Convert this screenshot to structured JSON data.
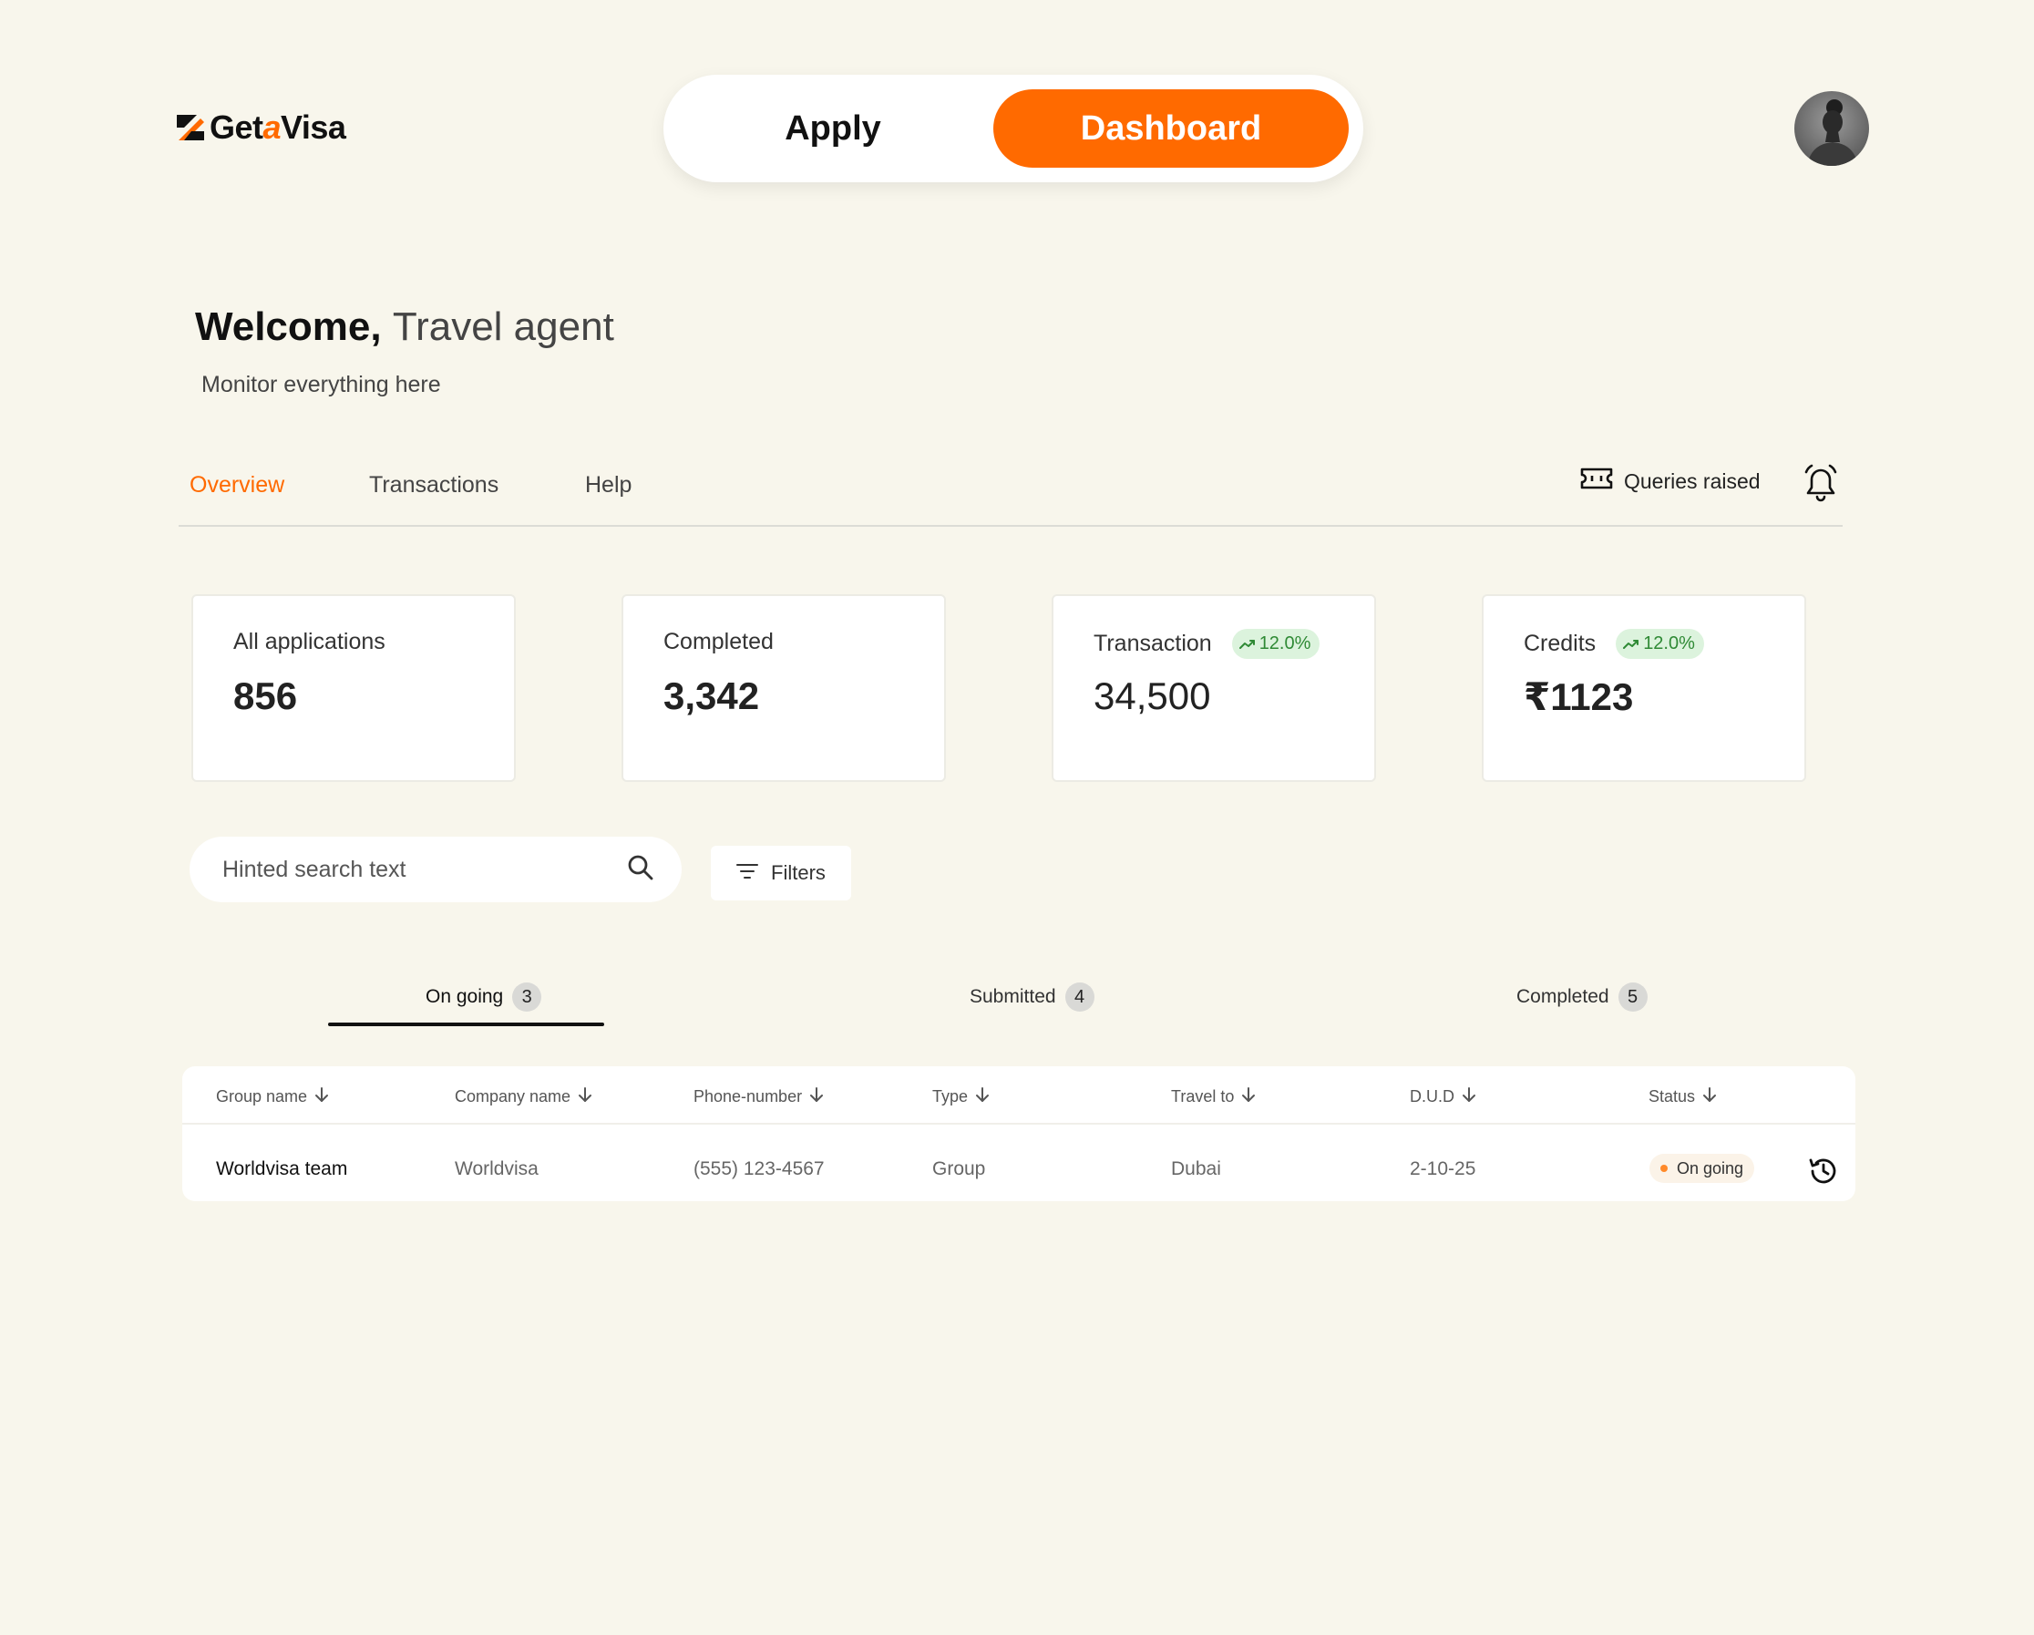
{
  "brand": {
    "name_prefix": "Get",
    "name_mid": "a",
    "name_suffix": "Visa",
    "accent": "#ff6a00"
  },
  "mode_toggle": {
    "apply_label": "Apply",
    "dashboard_label": "Dashboard",
    "active": "Dashboard"
  },
  "welcome": {
    "greeting": "Welcome,",
    "role": "Travel agent",
    "subtitle": "Monitor everything here"
  },
  "nav": {
    "tabs": [
      {
        "label": "Overview",
        "active": true
      },
      {
        "label": "Transactions",
        "active": false
      },
      {
        "label": "Help",
        "active": false
      }
    ],
    "queries_label": "Queries raised",
    "queries_icon": "ticket-icon",
    "notifications_icon": "bell-icon"
  },
  "stats": [
    {
      "label": "All applications",
      "value": "856",
      "trend": ""
    },
    {
      "label": "Completed",
      "value": "3,342",
      "trend": ""
    },
    {
      "label": "Transaction",
      "value": "34,500",
      "trend": "12.0%"
    },
    {
      "label": "Credits",
      "value": "₹1123",
      "trend": "12.0%"
    }
  ],
  "search": {
    "placeholder": "Hinted search text",
    "value": ""
  },
  "filters_label": "Filters",
  "status_tabs": [
    {
      "label": "On going",
      "count": "3",
      "active": true
    },
    {
      "label": "Submitted",
      "count": "4",
      "active": false
    },
    {
      "label": "Completed",
      "count": "5",
      "active": false
    }
  ],
  "table": {
    "columns": [
      "Group name",
      "Company name",
      "Phone-number",
      "Type",
      "Travel to",
      "D.U.D",
      "Status"
    ],
    "rows": [
      {
        "group_name": "Worldvisa team",
        "company_name": "Worldvisa",
        "phone": "(555) 123-4567",
        "type": "Group",
        "travel_to": "Dubai",
        "dud": "2-10-25",
        "status": "On going"
      }
    ]
  }
}
